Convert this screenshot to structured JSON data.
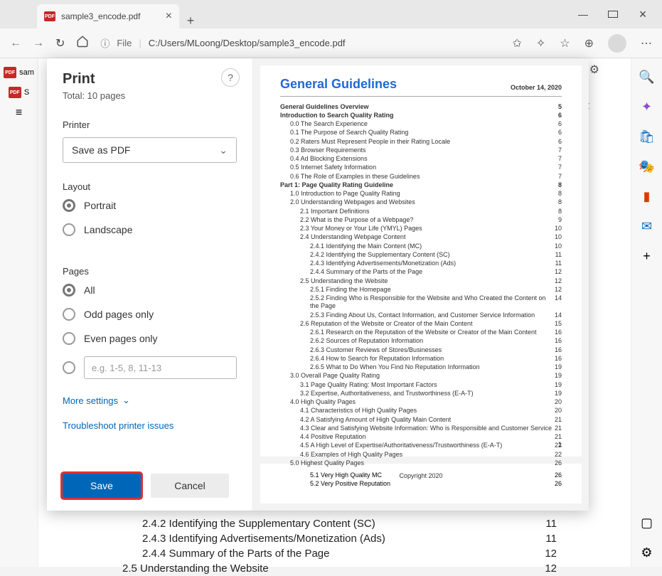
{
  "window": {
    "tab_title": "sample3_encode.pdf"
  },
  "addressbar": {
    "scheme_label": "File",
    "url": "C:/Users/MLoong/Desktop/sample3_encode.pdf"
  },
  "left_tabs": {
    "t1": "sam",
    "t2": "S"
  },
  "print": {
    "title": "Print",
    "total": "Total: 10 pages",
    "printer_label": "Printer",
    "printer_value": "Save as PDF",
    "layout_label": "Layout",
    "layout_portrait": "Portrait",
    "layout_landscape": "Landscape",
    "pages_label": "Pages",
    "pages_all": "All",
    "pages_odd": "Odd pages only",
    "pages_even": "Even pages only",
    "pages_custom_ph": "e.g. 1-5, 8, 11-13",
    "more": "More settings",
    "troubleshoot": "Troubleshoot printer issues",
    "save": "Save",
    "cancel": "Cancel"
  },
  "preview": {
    "title": "General Guidelines",
    "date": "October 14, 2020",
    "copyright": "Copyright 2020",
    "page1": "1",
    "toc": [
      {
        "l": 0,
        "t": "General Guidelines Overview",
        "p": "5"
      },
      {
        "l": 0,
        "t": "Introduction to Search Quality Rating",
        "p": "6"
      },
      {
        "l": 1,
        "t": "0.0 The Search Experience",
        "p": "6"
      },
      {
        "l": 1,
        "t": "0.1 The Purpose of Search Quality Rating",
        "p": "6"
      },
      {
        "l": 1,
        "t": "0.2 Raters Must Represent People in their Rating Locale",
        "p": "6"
      },
      {
        "l": 1,
        "t": "0.3 Browser Requirements",
        "p": "7"
      },
      {
        "l": 1,
        "t": "0.4 Ad Blocking Extensions",
        "p": "7"
      },
      {
        "l": 1,
        "t": "0.5 Internet Safety Information",
        "p": "7"
      },
      {
        "l": 1,
        "t": "0.6 The Role of Examples in these Guidelines",
        "p": "7"
      },
      {
        "l": 0,
        "t": "Part 1: Page Quality Rating Guideline",
        "p": "8"
      },
      {
        "l": 1,
        "t": "1.0 Introduction to Page Quality Rating",
        "p": "8"
      },
      {
        "l": 1,
        "t": "2.0 Understanding Webpages and Websites",
        "p": "8"
      },
      {
        "l": 2,
        "t": "2.1 Important Definitions",
        "p": "8"
      },
      {
        "l": 2,
        "t": "2.2 What is the Purpose of a Webpage?",
        "p": "9"
      },
      {
        "l": 2,
        "t": "2.3 Your Money or Your Life (YMYL) Pages",
        "p": "10"
      },
      {
        "l": 2,
        "t": "2.4 Understanding Webpage Content",
        "p": "10"
      },
      {
        "l": 3,
        "t": "2.4.1 Identifying the Main Content (MC)",
        "p": "10"
      },
      {
        "l": 3,
        "t": "2.4.2 Identifying the Supplementary Content (SC)",
        "p": "11"
      },
      {
        "l": 3,
        "t": "2.4.3 Identifying Advertisements/Monetization (Ads)",
        "p": "11"
      },
      {
        "l": 3,
        "t": "2.4.4 Summary of the Parts of the Page",
        "p": "12"
      },
      {
        "l": 2,
        "t": "2.5 Understanding the Website",
        "p": "12"
      },
      {
        "l": 3,
        "t": "2.5.1 Finding the Homepage",
        "p": "12"
      },
      {
        "l": 3,
        "t": "2.5.2 Finding Who is Responsible for the Website and Who Created the Content on the Page",
        "p": "14"
      },
      {
        "l": 3,
        "t": "2.5.3 Finding About Us, Contact Information, and Customer Service Information",
        "p": "14"
      },
      {
        "l": 2,
        "t": "2.6 Reputation of the Website or Creator of the Main Content",
        "p": "15"
      },
      {
        "l": 3,
        "t": "2.6.1 Research on the Reputation of the Website or Creator of the Main Content",
        "p": "16"
      },
      {
        "l": 3,
        "t": "2.6.2 Sources of Reputation Information",
        "p": "16"
      },
      {
        "l": 3,
        "t": "2.6.3 Customer Reviews of Stores/Businesses",
        "p": "16"
      },
      {
        "l": 3,
        "t": "2.6.4 How to Search for Reputation Information",
        "p": "16"
      },
      {
        "l": 3,
        "t": "2.6.5 What to Do When You Find No Reputation Information",
        "p": "19"
      },
      {
        "l": 1,
        "t": "3.0 Overall Page Quality Rating",
        "p": "19"
      },
      {
        "l": 2,
        "t": "3.1 Page Quality Rating: Most Important Factors",
        "p": "19"
      },
      {
        "l": 2,
        "t": "3.2 Expertise, Authoritativeness, and Trustworthiness (E-A-T)",
        "p": "19"
      },
      {
        "l": 1,
        "t": "4.0 High Quality Pages",
        "p": "20"
      },
      {
        "l": 2,
        "t": "4.1 Characteristics of High Quality Pages",
        "p": "20"
      },
      {
        "l": 2,
        "t": "4.2 A Satisfying Amount of High Quality Main Content",
        "p": "21"
      },
      {
        "l": 2,
        "t": "4.3 Clear and Satisfying Website Information: Who is Responsible and Customer Service",
        "p": "21"
      },
      {
        "l": 2,
        "t": "4.4 Positive Reputation",
        "p": "21"
      },
      {
        "l": 2,
        "t": "4.5 A High Level of Expertise/Authoritativeness/Trustworthiness (E-A-T)",
        "p": "22"
      },
      {
        "l": 2,
        "t": "4.6 Examples of High Quality Pages",
        "p": "22"
      },
      {
        "l": 1,
        "t": "5.0 Highest Quality Pages",
        "p": "26"
      }
    ],
    "p2a": {
      "t": "5.1 Very High Quality MC",
      "p": "26"
    },
    "p2b": {
      "t": "5.2 Very Positive Reputation",
      "p": "26"
    }
  },
  "behind": {
    "r1": {
      "t": "2.4.2 Identifying the Supplementary Content (SC)",
      "p": "11"
    },
    "r2": {
      "t": "2.4.3 Identifying Advertisements/Monetization (Ads)",
      "p": "11"
    },
    "r3": {
      "t": "2.4.4 Summary of the Parts of the Page",
      "p": "12"
    },
    "r4": {
      "t": "2.5 Understanding the Website",
      "p": "12"
    }
  }
}
